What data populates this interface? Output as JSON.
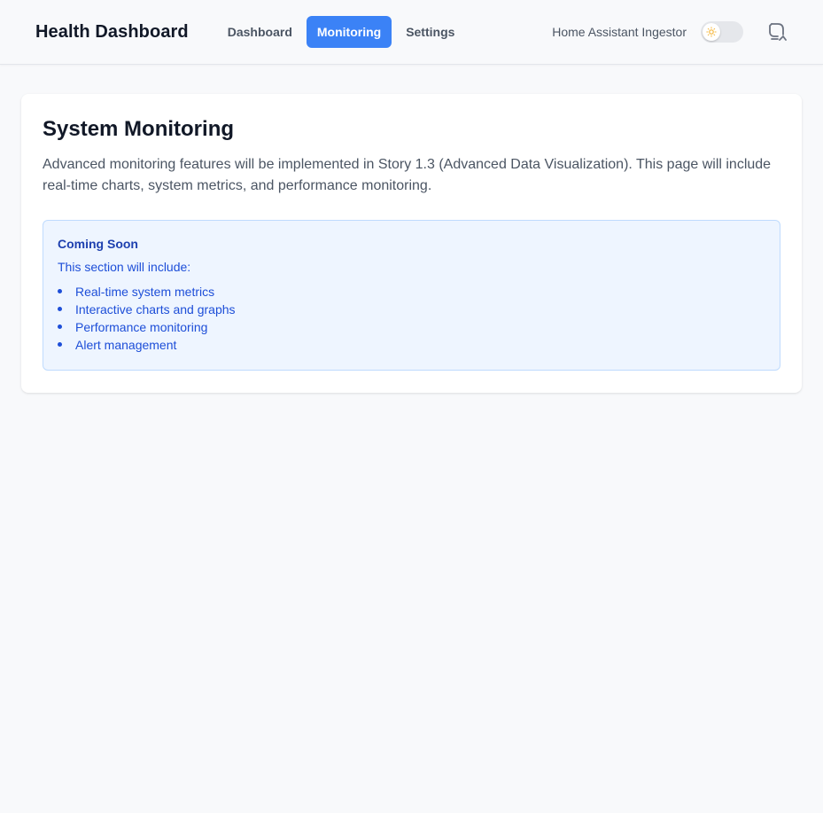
{
  "header": {
    "brand": "Health Dashboard",
    "nav": [
      {
        "label": "Dashboard",
        "active": false
      },
      {
        "label": "Monitoring",
        "active": true
      },
      {
        "label": "Settings",
        "active": false
      }
    ],
    "app_name": "Home Assistant Ingestor",
    "theme_toggle": {
      "icon": "sun-icon",
      "state": "off"
    },
    "refresh_icon": "refresh-icon"
  },
  "main": {
    "title": "System Monitoring",
    "description": "Advanced monitoring features will be implemented in Story 1.3 (Advanced Data Visualization). This page will include real-time charts, system metrics, and performance monitoring.",
    "info_box": {
      "title": "Coming Soon",
      "subtitle": "This section will include:",
      "items": [
        "Real-time system metrics",
        "Interactive charts and graphs",
        "Performance monitoring",
        "Alert management"
      ]
    }
  },
  "colors": {
    "accent": "#3b82f6",
    "info_bg": "#eef5ff",
    "info_text": "#1d4ed8"
  }
}
